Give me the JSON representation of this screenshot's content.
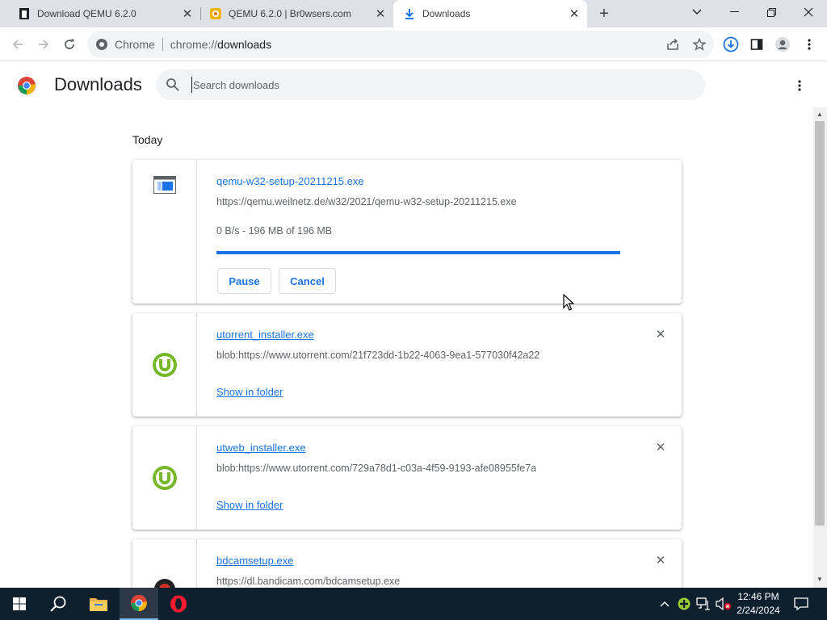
{
  "tabs": [
    {
      "title": "Download QEMU 6.2.0",
      "favicon": "qemu-page-icon",
      "active": false
    },
    {
      "title": "QEMU 6.2.0 | Br0wsers.com",
      "favicon": "browsers-site-icon",
      "active": false
    },
    {
      "title": "Downloads",
      "favicon": "download-icon",
      "active": true
    }
  ],
  "omnibox": {
    "site_label": "Chrome",
    "url_scheme": "chrome://",
    "url_path": "downloads"
  },
  "page": {
    "title": "Downloads",
    "search_placeholder": "Search downloads",
    "date_group": "Today"
  },
  "downloads": [
    {
      "filename": "qemu-w32-setup-20211215.exe",
      "url": "https://qemu.weilnetz.de/w32/2021/qemu-w32-setup-20211215.exe",
      "status": "0 B/s - 196 MB of 196 MB",
      "progress_percent": 100,
      "pause_label": "Pause",
      "cancel_label": "Cancel"
    },
    {
      "filename": "utorrent_installer.exe",
      "url": "blob:https://www.utorrent.com/21f723dd-1b22-4063-9ea1-577030f42a22",
      "show_in_folder": "Show in folder"
    },
    {
      "filename": "utweb_installer.exe",
      "url": "blob:https://www.utorrent.com/729a78d1-c03a-4f59-9193-afe08955fe7a",
      "show_in_folder": "Show in folder"
    },
    {
      "filename": "bdcamsetup.exe",
      "url": "https://dl.bandicam.com/bdcamsetup.exe"
    }
  ],
  "taskbar": {
    "time": "12:46 PM",
    "date": "2/24/2024"
  },
  "colors": {
    "accent": "#1a73e8",
    "utorrent_green": "#76b82a",
    "taskbar": "#101f2e"
  }
}
